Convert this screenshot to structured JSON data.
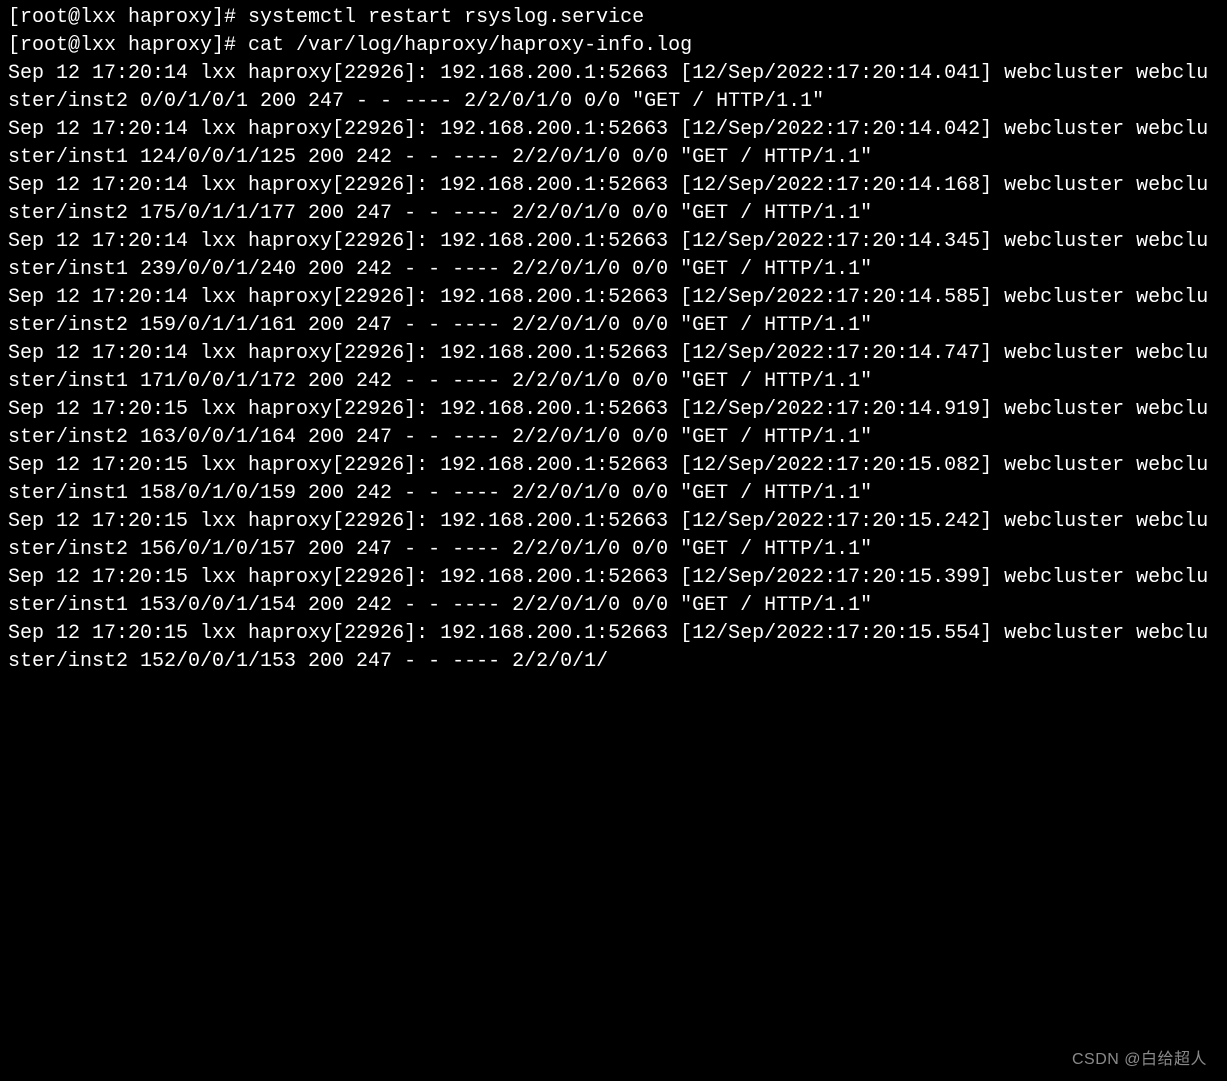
{
  "terminal": {
    "lines": [
      "[root@lxx haproxy]# systemctl restart rsyslog.service",
      "[root@lxx haproxy]# cat /var/log/haproxy/haproxy-info.log",
      "Sep 12 17:20:14 lxx haproxy[22926]: 192.168.200.1:52663 [12/Sep/2022:17:20:14.041] webcluster webcluster/inst2 0/0/1/0/1 200 247 - - ---- 2/2/0/1/0 0/0 \"GET / HTTP/1.1\"",
      "Sep 12 17:20:14 lxx haproxy[22926]: 192.168.200.1:52663 [12/Sep/2022:17:20:14.042] webcluster webcluster/inst1 124/0/0/1/125 200 242 - - ---- 2/2/0/1/0 0/0 \"GET / HTTP/1.1\"",
      "Sep 12 17:20:14 lxx haproxy[22926]: 192.168.200.1:52663 [12/Sep/2022:17:20:14.168] webcluster webcluster/inst2 175/0/1/1/177 200 247 - - ---- 2/2/0/1/0 0/0 \"GET / HTTP/1.1\"",
      "Sep 12 17:20:14 lxx haproxy[22926]: 192.168.200.1:52663 [12/Sep/2022:17:20:14.345] webcluster webcluster/inst1 239/0/0/1/240 200 242 - - ---- 2/2/0/1/0 0/0 \"GET / HTTP/1.1\"",
      "Sep 12 17:20:14 lxx haproxy[22926]: 192.168.200.1:52663 [12/Sep/2022:17:20:14.585] webcluster webcluster/inst2 159/0/1/1/161 200 247 - - ---- 2/2/0/1/0 0/0 \"GET / HTTP/1.1\"",
      "Sep 12 17:20:14 lxx haproxy[22926]: 192.168.200.1:52663 [12/Sep/2022:17:20:14.747] webcluster webcluster/inst1 171/0/0/1/172 200 242 - - ---- 2/2/0/1/0 0/0 \"GET / HTTP/1.1\"",
      "Sep 12 17:20:15 lxx haproxy[22926]: 192.168.200.1:52663 [12/Sep/2022:17:20:14.919] webcluster webcluster/inst2 163/0/0/1/164 200 247 - - ---- 2/2/0/1/0 0/0 \"GET / HTTP/1.1\"",
      "Sep 12 17:20:15 lxx haproxy[22926]: 192.168.200.1:52663 [12/Sep/2022:17:20:15.082] webcluster webcluster/inst1 158/0/1/0/159 200 242 - - ---- 2/2/0/1/0 0/0 \"GET / HTTP/1.1\"",
      "Sep 12 17:20:15 lxx haproxy[22926]: 192.168.200.1:52663 [12/Sep/2022:17:20:15.242] webcluster webcluster/inst2 156/0/1/0/157 200 247 - - ---- 2/2/0/1/0 0/0 \"GET / HTTP/1.1\"",
      "Sep 12 17:20:15 lxx haproxy[22926]: 192.168.200.1:52663 [12/Sep/2022:17:20:15.399] webcluster webcluster/inst1 153/0/0/1/154 200 242 - - ---- 2/2/0/1/0 0/0 \"GET / HTTP/1.1\"",
      "Sep 12 17:20:15 lxx haproxy[22926]: 192.168.200.1:52663 [12/Sep/2022:17:20:15.554] webcluster webcluster/inst2 152/0/0/1/153 200 247 - - ---- 2/2/0/1/"
    ]
  },
  "watermark": "CSDN @白给超人"
}
